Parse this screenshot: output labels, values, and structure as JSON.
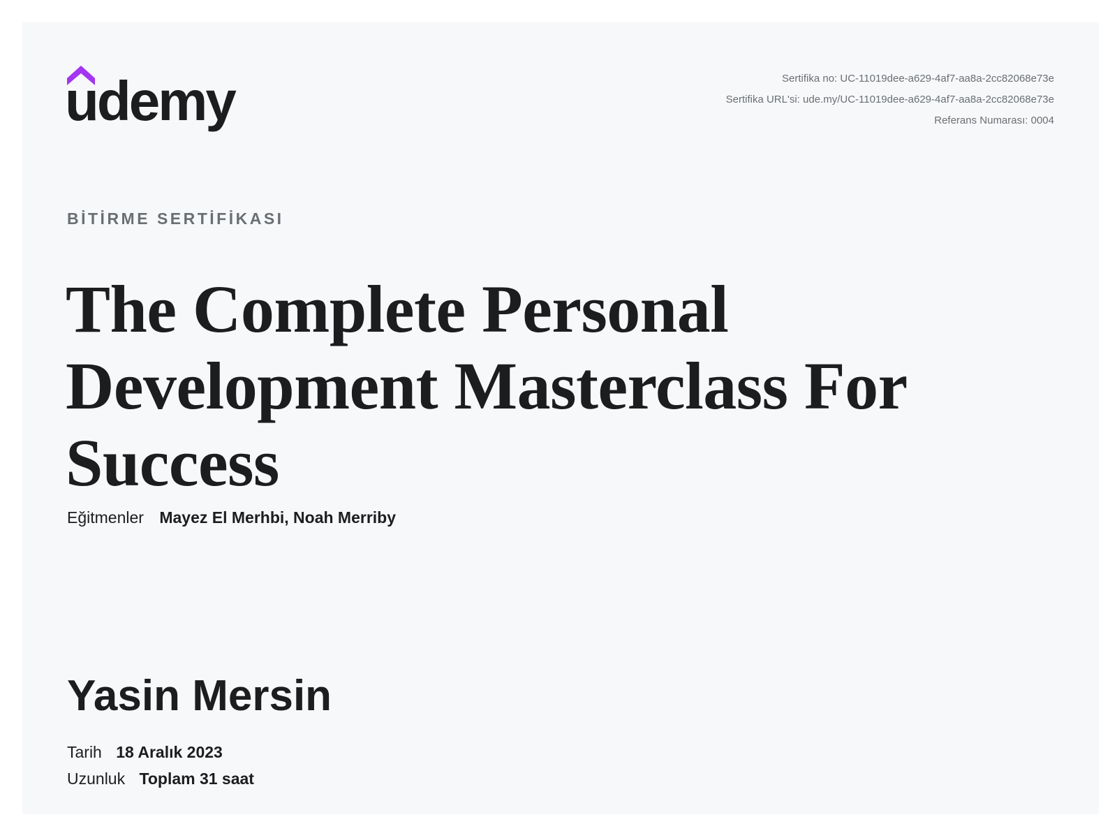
{
  "brand": {
    "logo_text": "udemy",
    "color_text": "#1c1d1f",
    "color_accent": "#a435f0"
  },
  "meta": {
    "certificate_no": "Sertifika no: UC-11019dee-a629-4af7-aa8a-2cc82068e73e",
    "certificate_url": "Sertifika URL'si: ude.my/UC-11019dee-a629-4af7-aa8a-2cc82068e73e",
    "reference_no": "Referans Numarası: 0004"
  },
  "eyebrow": "BİTİRME SERTİFİKASI",
  "course_title": "The Complete Personal Development Masterclass For Success",
  "instructors": {
    "label": "Eğitmenler",
    "names": "Mayez El Merhbi,  Noah Merriby"
  },
  "recipient": "Yasin Mersin",
  "date": {
    "label": "Tarih",
    "value": "18 Aralık 2023"
  },
  "length": {
    "label": "Uzunluk",
    "value": "Toplam 31 saat"
  },
  "colors": {
    "background": "#f7f8fa",
    "muted_text": "#6a6f73"
  }
}
